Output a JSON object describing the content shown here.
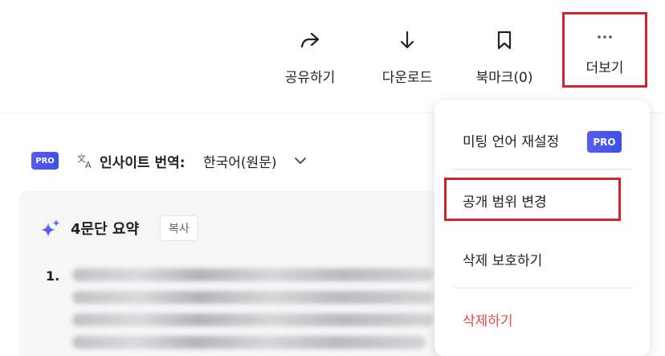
{
  "toolbar": {
    "share_label": "공유하기",
    "download_label": "다운로드",
    "bookmark_label": "북마크(0)",
    "more_label": "더보기"
  },
  "translation": {
    "pro_badge": "PRO",
    "label": "인사이트 번역:",
    "value": "한국어(원문)"
  },
  "summary": {
    "title": "4문단 요약",
    "copy_label": "복사",
    "item_number": "1.",
    "line_tails": [
      "브",
      "당",
      "특",
      "t"
    ]
  },
  "menu": {
    "reset_language_label": "미팅 언어 재설정",
    "reset_language_badge": "PRO",
    "change_visibility_label": "공개 범위 변경",
    "delete_protect_label": "삭제 보호하기",
    "delete_label": "삭제하기"
  },
  "colors": {
    "highlight_box": "#d1222e",
    "pro_badge": "#4a52ec",
    "danger_text": "#e5484d",
    "card_bg": "#f6f6f7"
  },
  "icons": {
    "share": "share-arrow-icon",
    "download": "download-arrow-icon",
    "bookmark": "bookmark-icon",
    "more": "more-dots-icon",
    "translate": "translate-icon",
    "chevron": "chevron-down-icon",
    "sparkle": "sparkle-icon"
  }
}
